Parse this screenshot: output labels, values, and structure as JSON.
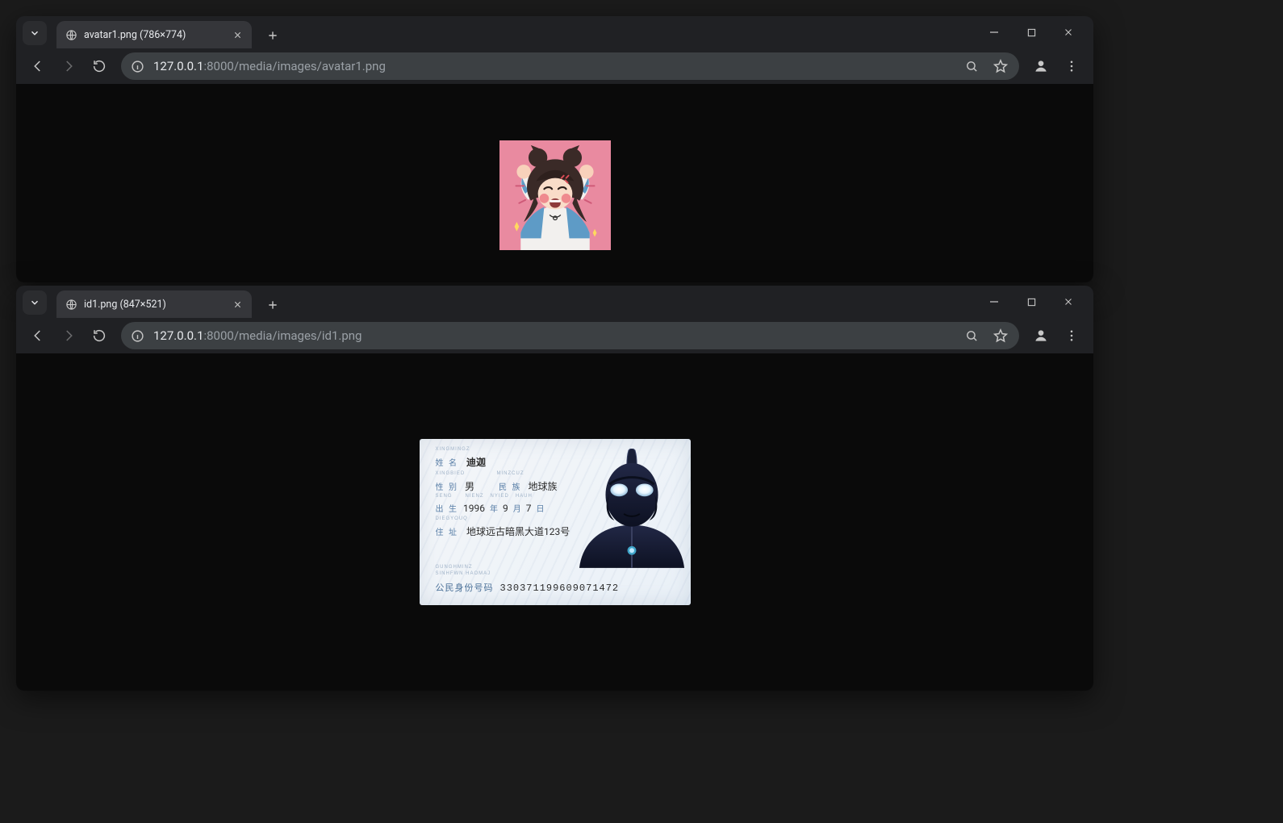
{
  "windows": [
    {
      "tab_title": "avatar1.png (786×774)",
      "url_host": "127.0.0.1",
      "url_port": ":8000",
      "url_path": "/media/images/avatar1.png"
    },
    {
      "tab_title": "id1.png (847×521)",
      "url_host": "127.0.0.1",
      "url_port": ":8000",
      "url_path": "/media/images/id1.png"
    }
  ],
  "id_card": {
    "pinyin_name": "XINGMINGZ",
    "name_label": "姓 名",
    "name_value": "迪迦",
    "pinyin_sex": "XINGBIED",
    "pinyin_minzu": "MINZCUZ",
    "sex_label": "性 别",
    "sex_value": "男",
    "ethnic_label": "民 族",
    "ethnic_value": "地球族",
    "pinyin_birth": "SENG      NIENZ   NYIED   HAUH",
    "birth_label": "出 生",
    "birth_year": "1996",
    "birth_year_unit": "年",
    "birth_month": "9",
    "birth_month_unit": "月",
    "birth_day": "7",
    "birth_day_unit": "日",
    "pinyin_addr": "DIEGYOUQ",
    "addr_label": "住 址",
    "addr_value": "地球远古暗黑大道123号",
    "pinyin_num1": "GUNGHMINZ",
    "pinyin_num2": "SINHFWN HAOMAJ",
    "num_label": "公民身份号码",
    "num_value": "330371199609071472"
  }
}
